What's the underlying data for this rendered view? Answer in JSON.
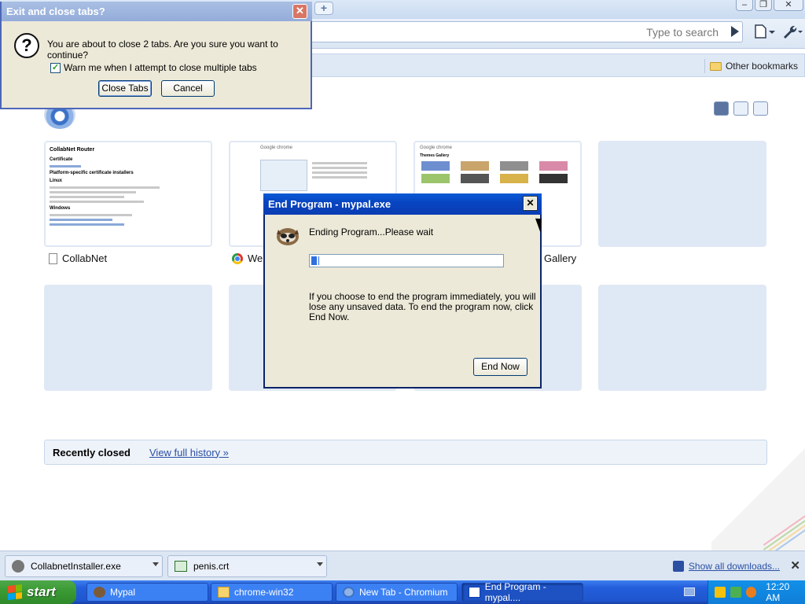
{
  "browser": {
    "newtab_glyph": "+",
    "window_controls": {
      "minimize": "‒",
      "restore": "❐",
      "close": "✕"
    },
    "omnibox": {
      "placeholder": "Type to search"
    },
    "bookmarks": {
      "other_label": "Other bookmarks"
    }
  },
  "ntp": {
    "tiles": [
      {
        "title": "CollabNet",
        "icon": "document-icon",
        "thumb": {
          "heading": "CollabNet Router",
          "sub1": "Certificate",
          "sub2": "Platform-specific certificate installers",
          "sub3": "Linux",
          "sub4": "Windows"
        }
      },
      {
        "title": "We",
        "icon": "chrome-favicon",
        "thumb": {
          "brand": "Google chrome"
        }
      },
      {
        "title": "Gallery",
        "icon": "chrome-favicon",
        "thumb": {
          "brand": "Google chrome",
          "sub": "Themes Gallery"
        }
      },
      {
        "title": "",
        "icon": ""
      },
      {
        "title": "",
        "icon": ""
      },
      {
        "title": "",
        "icon": ""
      },
      {
        "title": "",
        "icon": ""
      },
      {
        "title": "",
        "icon": ""
      }
    ],
    "recently_closed": {
      "title": "Recently closed",
      "link": "View full history »"
    }
  },
  "downloads": {
    "items": [
      {
        "filename": "CollabnetInstaller.exe",
        "icon": "exe-icon"
      },
      {
        "filename": "penis.crt",
        "icon": "certificate-icon"
      }
    ],
    "show_all": "Show all downloads...",
    "close_glyph": "✕"
  },
  "exit_dialog": {
    "title": "Exit and close tabs?",
    "close_glyph": "✕",
    "icon_glyph": "?",
    "message": "You are about to close 2 tabs. Are you sure you want to continue?",
    "warn_label": "Warn me when I attempt to close multiple tabs",
    "warn_checked": true,
    "check_glyph": "✓",
    "buttons": {
      "close_tabs": "Close Tabs",
      "cancel": "Cancel"
    }
  },
  "end_dialog": {
    "title": "End Program - mypal.exe",
    "close_glyph": "✕",
    "status": "Ending Program...Please wait",
    "progress": 0.04,
    "warning": "If you choose to end the program immediately, you will lose any unsaved data. To end the program now, click End Now.",
    "button": "End Now"
  },
  "taskbar": {
    "start_label": "start",
    "tasks": [
      {
        "label": "Mypal",
        "icon": "raccoon-icon",
        "active": false
      },
      {
        "label": "chrome-win32",
        "icon": "folder-icon",
        "active": false
      },
      {
        "label": "New Tab - Chromium",
        "icon": "chromium-icon",
        "active": false
      },
      {
        "label": "End Program - mypal....",
        "icon": "window-icon",
        "active": true
      }
    ],
    "clock": "12:20 AM"
  },
  "colors": {
    "xp_blue": "#245edb",
    "start_green": "#3c9b35",
    "ntp_tile": "#dfe8f5",
    "dialog_face": "#ece9d8"
  }
}
